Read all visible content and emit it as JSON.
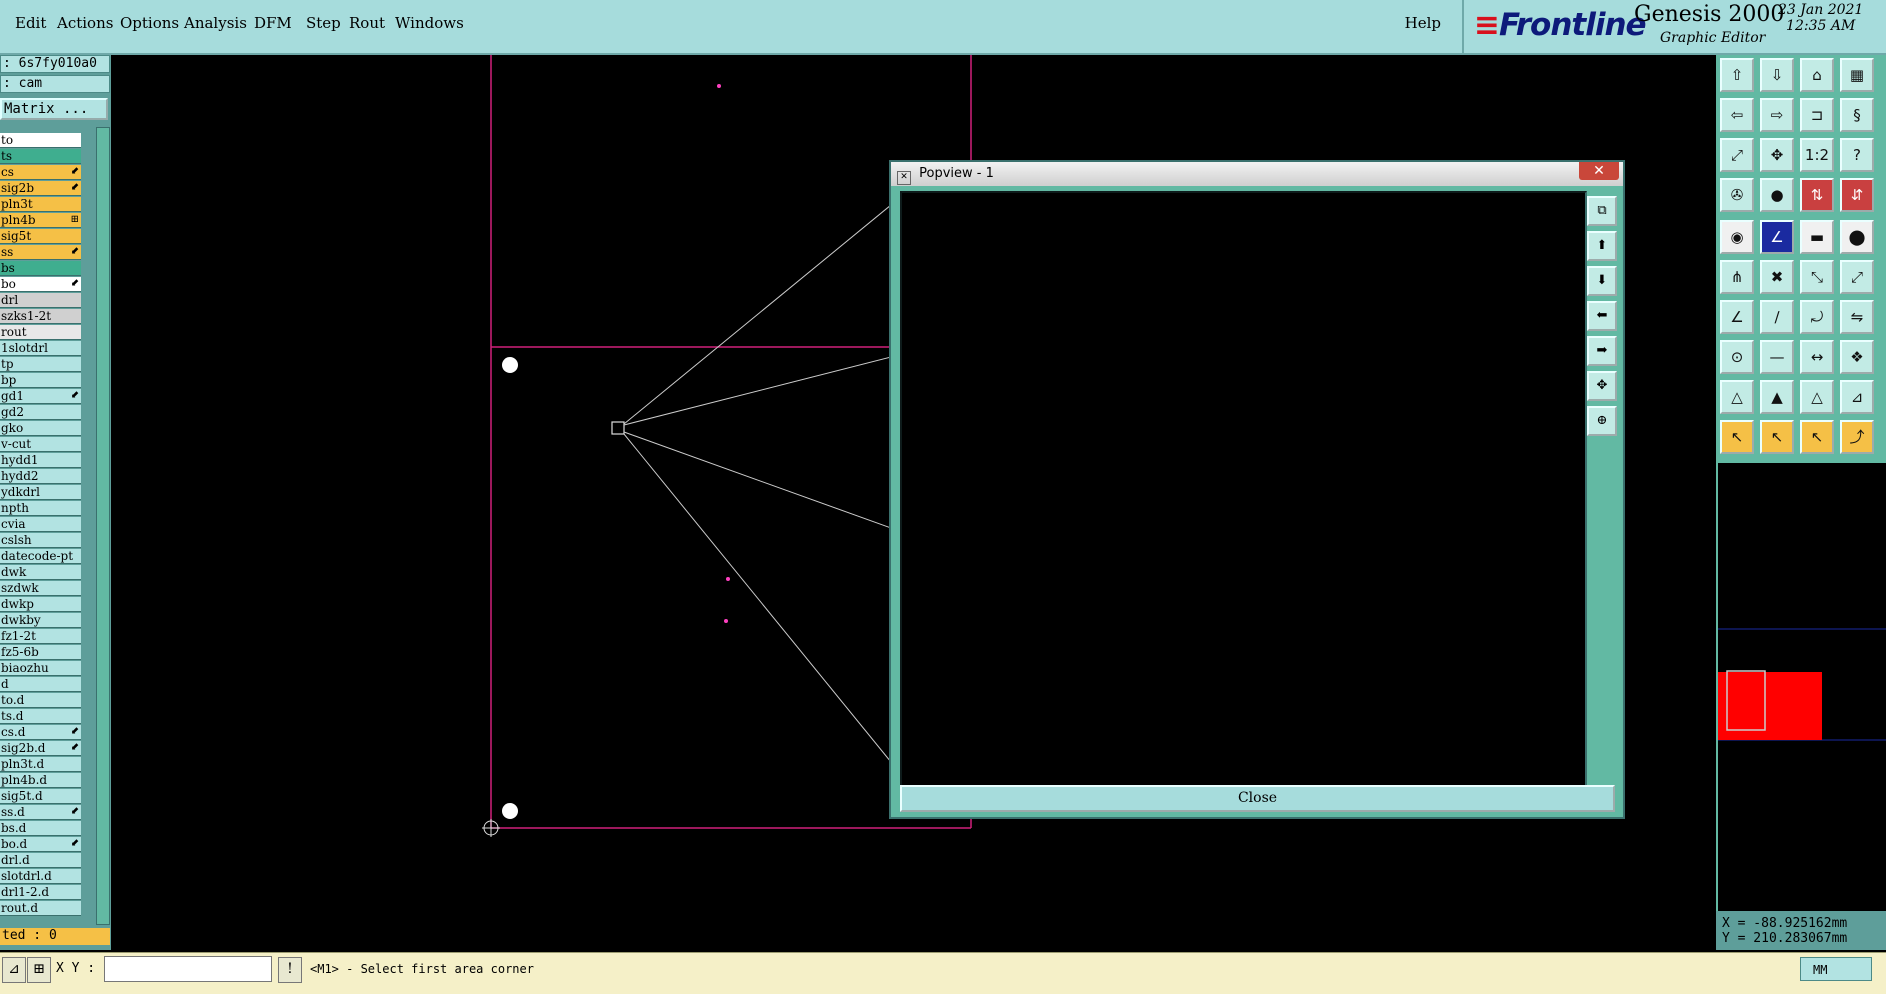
{
  "menubar": {
    "items": [
      "Edit",
      "Actions",
      "Options",
      "Analysis",
      "DFM",
      "Step",
      "Rout",
      "Windows"
    ],
    "help": "Help"
  },
  "brand": {
    "logo": "Frontline",
    "product": "Genesis 2000",
    "subtitle": "Graphic Editor",
    "date": "23 Jan 2021",
    "time": "12:35 AM"
  },
  "left": {
    "job": ": 6s7fy010a0",
    "step": ": cam",
    "matrix_label": "Matrix ...",
    "layers": [
      {
        "name": "to",
        "color": "#ffffff",
        "mark": ""
      },
      {
        "name": "ts",
        "color": "#3fae8f",
        "mark": ""
      },
      {
        "name": "cs",
        "color": "#f5c046",
        "mark": "⬋"
      },
      {
        "name": "sig2b",
        "color": "#f5c046",
        "mark": "⬋"
      },
      {
        "name": "pln3t",
        "color": "#f5c046",
        "mark": ""
      },
      {
        "name": "pln4b",
        "color": "#f5c046",
        "mark": "⊞"
      },
      {
        "name": "sig5t",
        "color": "#f5c046",
        "mark": ""
      },
      {
        "name": "ss",
        "color": "#f5c046",
        "mark": "⬋"
      },
      {
        "name": "bs",
        "color": "#3fae8f",
        "mark": ""
      },
      {
        "name": "bo",
        "color": "#ffffff",
        "mark": "⬋"
      },
      {
        "name": "drl",
        "color": "#d0d0d0",
        "mark": ""
      },
      {
        "name": "szks1-2t",
        "color": "#d0d0d0",
        "mark": ""
      },
      {
        "name": "rout",
        "color": "#e8e8e8",
        "mark": ""
      },
      {
        "name": "1slotdrl",
        "color": "#b2e3e2",
        "mark": ""
      },
      {
        "name": "tp",
        "color": "#b2e3e2",
        "mark": ""
      },
      {
        "name": "bp",
        "color": "#b2e3e2",
        "mark": ""
      },
      {
        "name": "gd1",
        "color": "#b2e3e2",
        "mark": "⬋"
      },
      {
        "name": "gd2",
        "color": "#b2e3e2",
        "mark": ""
      },
      {
        "name": "gko",
        "color": "#b2e3e2",
        "mark": ""
      },
      {
        "name": "v-cut",
        "color": "#b2e3e2",
        "mark": ""
      },
      {
        "name": "hydd1",
        "color": "#b2e3e2",
        "mark": ""
      },
      {
        "name": "hydd2",
        "color": "#b2e3e2",
        "mark": ""
      },
      {
        "name": "ydkdrl",
        "color": "#b2e3e2",
        "mark": ""
      },
      {
        "name": "npth",
        "color": "#b2e3e2",
        "mark": ""
      },
      {
        "name": "cvia",
        "color": "#b2e3e2",
        "mark": ""
      },
      {
        "name": "cslsh",
        "color": "#b2e3e2",
        "mark": ""
      },
      {
        "name": "datecode-pt",
        "color": "#b2e3e2",
        "mark": ""
      },
      {
        "name": "dwk",
        "color": "#b2e3e2",
        "mark": ""
      },
      {
        "name": "szdwk",
        "color": "#b2e3e2",
        "mark": ""
      },
      {
        "name": "dwkp",
        "color": "#b2e3e2",
        "mark": ""
      },
      {
        "name": "dwkby",
        "color": "#b2e3e2",
        "mark": ""
      },
      {
        "name": "fz1-2t",
        "color": "#b2e3e2",
        "mark": ""
      },
      {
        "name": "fz5-6b",
        "color": "#b2e3e2",
        "mark": ""
      },
      {
        "name": "biaozhu",
        "color": "#b2e3e2",
        "mark": ""
      },
      {
        "name": "d",
        "color": "#b2e3e2",
        "mark": ""
      },
      {
        "name": "to.d",
        "color": "#b2e3e2",
        "mark": ""
      },
      {
        "name": "ts.d",
        "color": "#b2e3e2",
        "mark": ""
      },
      {
        "name": "cs.d",
        "color": "#b2e3e2",
        "mark": "⬋"
      },
      {
        "name": "sig2b.d",
        "color": "#b2e3e2",
        "mark": "⬋"
      },
      {
        "name": "pln3t.d",
        "color": "#b2e3e2",
        "mark": ""
      },
      {
        "name": "pln4b.d",
        "color": "#b2e3e2",
        "mark": ""
      },
      {
        "name": "sig5t.d",
        "color": "#b2e3e2",
        "mark": ""
      },
      {
        "name": "ss.d",
        "color": "#b2e3e2",
        "mark": "⬋"
      },
      {
        "name": "bs.d",
        "color": "#b2e3e2",
        "mark": ""
      },
      {
        "name": "bo.d",
        "color": "#b2e3e2",
        "mark": "⬋"
      },
      {
        "name": "drl.d",
        "color": "#b2e3e2",
        "mark": ""
      },
      {
        "name": "slotdrl.d",
        "color": "#b2e3e2",
        "mark": ""
      },
      {
        "name": "drl1-2.d",
        "color": "#b2e3e2",
        "mark": ""
      },
      {
        "name": "rout.d",
        "color": "#b2e3e2",
        "mark": ""
      }
    ],
    "selected": "ted : 0"
  },
  "popview": {
    "title": "Popview - 1",
    "close_label": "Close"
  },
  "coords": {
    "x": "X = -88.925162mm",
    "y": "Y = 210.283067mm"
  },
  "status": {
    "xy_label": "X Y :",
    "xy_value": "",
    "prompt": "<M1> - Select first area corner",
    "units": "MM"
  },
  "colors": {
    "menu_bg": "#a6dcdc",
    "panel_bg": "#62b9a3",
    "profile_line": "#d0207a",
    "overview_red": "#ff0000"
  }
}
